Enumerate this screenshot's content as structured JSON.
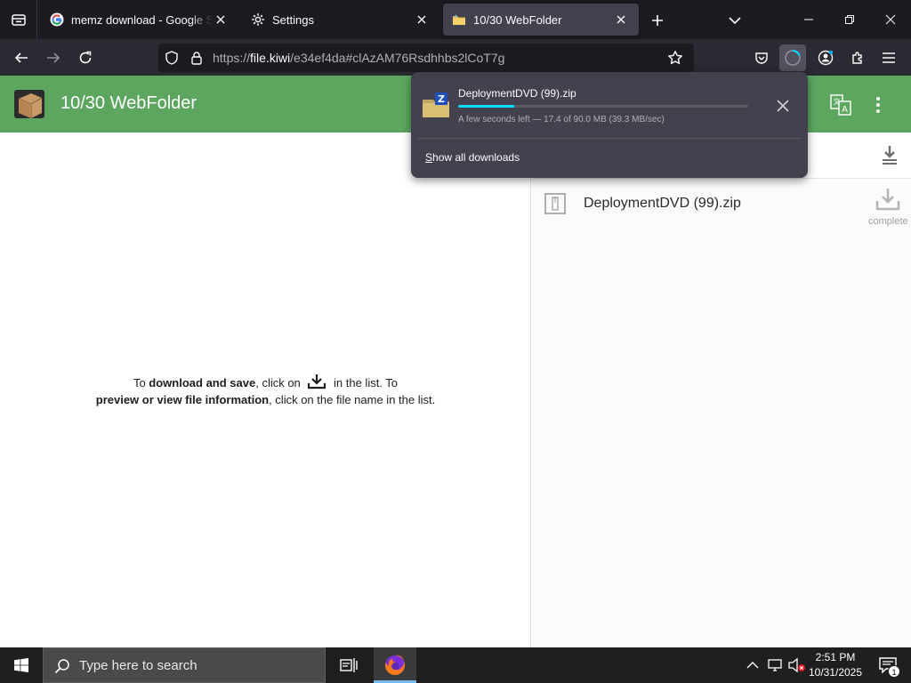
{
  "browser": {
    "tabs": [
      {
        "title": "memz download - Google Search",
        "favicon": "google-icon",
        "active": false
      },
      {
        "title": "Settings",
        "favicon": "gear-icon",
        "active": false
      },
      {
        "title": "10/30 WebFolder",
        "favicon": "folder-icon",
        "active": true
      }
    ],
    "url": {
      "scheme": "https://",
      "host": "file.kiwi",
      "path": "/e34ef4da#clAzAM76Rsdhhbs2lCoT7g"
    },
    "accent_color": "#00ddff"
  },
  "site": {
    "title": "10/30 WebFolder",
    "header_color": "#5ca660",
    "instructions": {
      "p1": "To ",
      "b1": "download and save",
      "p2": ", click on ",
      "p3": " in the list. To",
      "b2": "preview or view file information",
      "p4": ", click on the file name in the list."
    },
    "files": [
      {
        "name": "DeploymentDVD (99).zip",
        "status": "complete"
      }
    ]
  },
  "downloads_panel": {
    "item": {
      "name": "DeploymentDVD (99).zip",
      "progress": 0.193,
      "status": "A few seconds left — 17.4 of 90.0 MB (39.3 MB/sec)"
    },
    "show_all_key": "S",
    "show_all_rest": "how all downloads"
  },
  "taskbar": {
    "search_placeholder": "Type here to search",
    "time": "2:51 PM",
    "date": "10/31/2025",
    "notification_count": "1"
  }
}
